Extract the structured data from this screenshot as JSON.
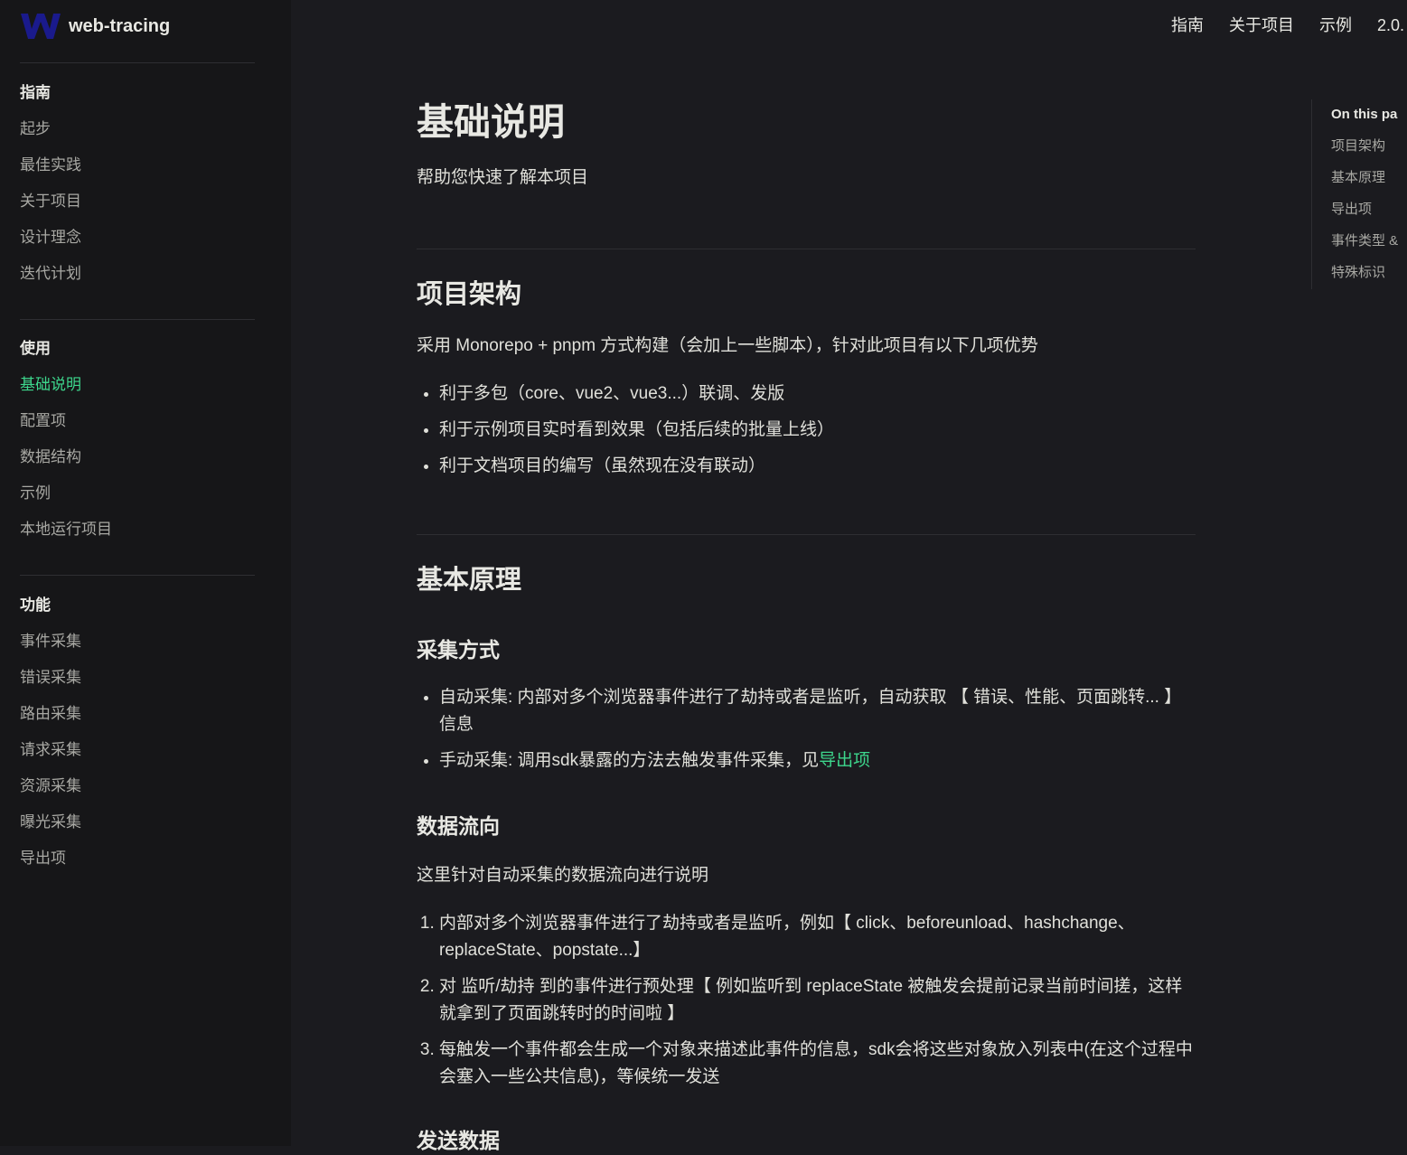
{
  "brand": {
    "name": "web-tracing",
    "logo_icon": "w-logo-icon",
    "logo_color": "#1a1a8c"
  },
  "topnav": {
    "items": [
      "指南",
      "关于项目",
      "示例",
      "2.0."
    ]
  },
  "sidebar": {
    "groups": [
      {
        "title": "指南",
        "items": [
          "起步",
          "最佳实践",
          "关于项目",
          "设计理念",
          "迭代计划"
        ]
      },
      {
        "title": "使用",
        "items": [
          "基础说明",
          "配置项",
          "数据结构",
          "示例",
          "本地运行项目"
        ]
      },
      {
        "title": "功能",
        "items": [
          "事件采集",
          "错误采集",
          "路由采集",
          "请求采集",
          "资源采集",
          "曝光采集",
          "导出项"
        ]
      }
    ],
    "active_item": "基础说明",
    "accent_color": "#3dd68c"
  },
  "main": {
    "title": "基础说明",
    "lead": "帮助您快速了解本项目",
    "sections": {
      "arch": {
        "title": "项目架构",
        "intro": "采用 Monorepo + pnpm 方式构建（会加上一些脚本），针对此项目有以下几项优势",
        "bullets": [
          "利于多包（core、vue2、vue3...）联调、发版",
          "利于示例项目实时看到效果（包括后续的批量上线）",
          "利于文档项目的编写（虽然现在没有联动）"
        ]
      },
      "principle": {
        "title": "基本原理",
        "collect": {
          "title": "采集方式",
          "auto": "自动采集: 内部对多个浏览器事件进行了劫持或者是监听，自动获取 【 错误、性能、页面跳转... 】信息",
          "manual_prefix": "手动采集: 调用sdk暴露的方法去触发事件采集，见",
          "manual_link": "导出项"
        },
        "flow": {
          "title": "数据流向",
          "intro": "这里针对自动采集的数据流向进行说明",
          "steps": [
            "内部对多个浏览器事件进行了劫持或者是监听，例如【 click、beforeunload、hashchange、replaceState、popstate...】",
            "对 监听/劫持 到的事件进行预处理【 例如监听到 replaceState 被触发会提前记录当前时间搓，这样就拿到了页面跳转时的时间啦 】",
            "每触发一个事件都会生成一个对象来描述此事件的信息，sdk会将这些对象放入列表中(在这个过程中会塞入一些公共信息)，等候统一发送"
          ]
        },
        "send": {
          "title": "发送数据"
        }
      }
    }
  },
  "toc": {
    "title": "On this pa",
    "items": [
      "项目架构",
      "基本原理",
      "导出项",
      "事件类型 &",
      "特殊标识"
    ]
  }
}
